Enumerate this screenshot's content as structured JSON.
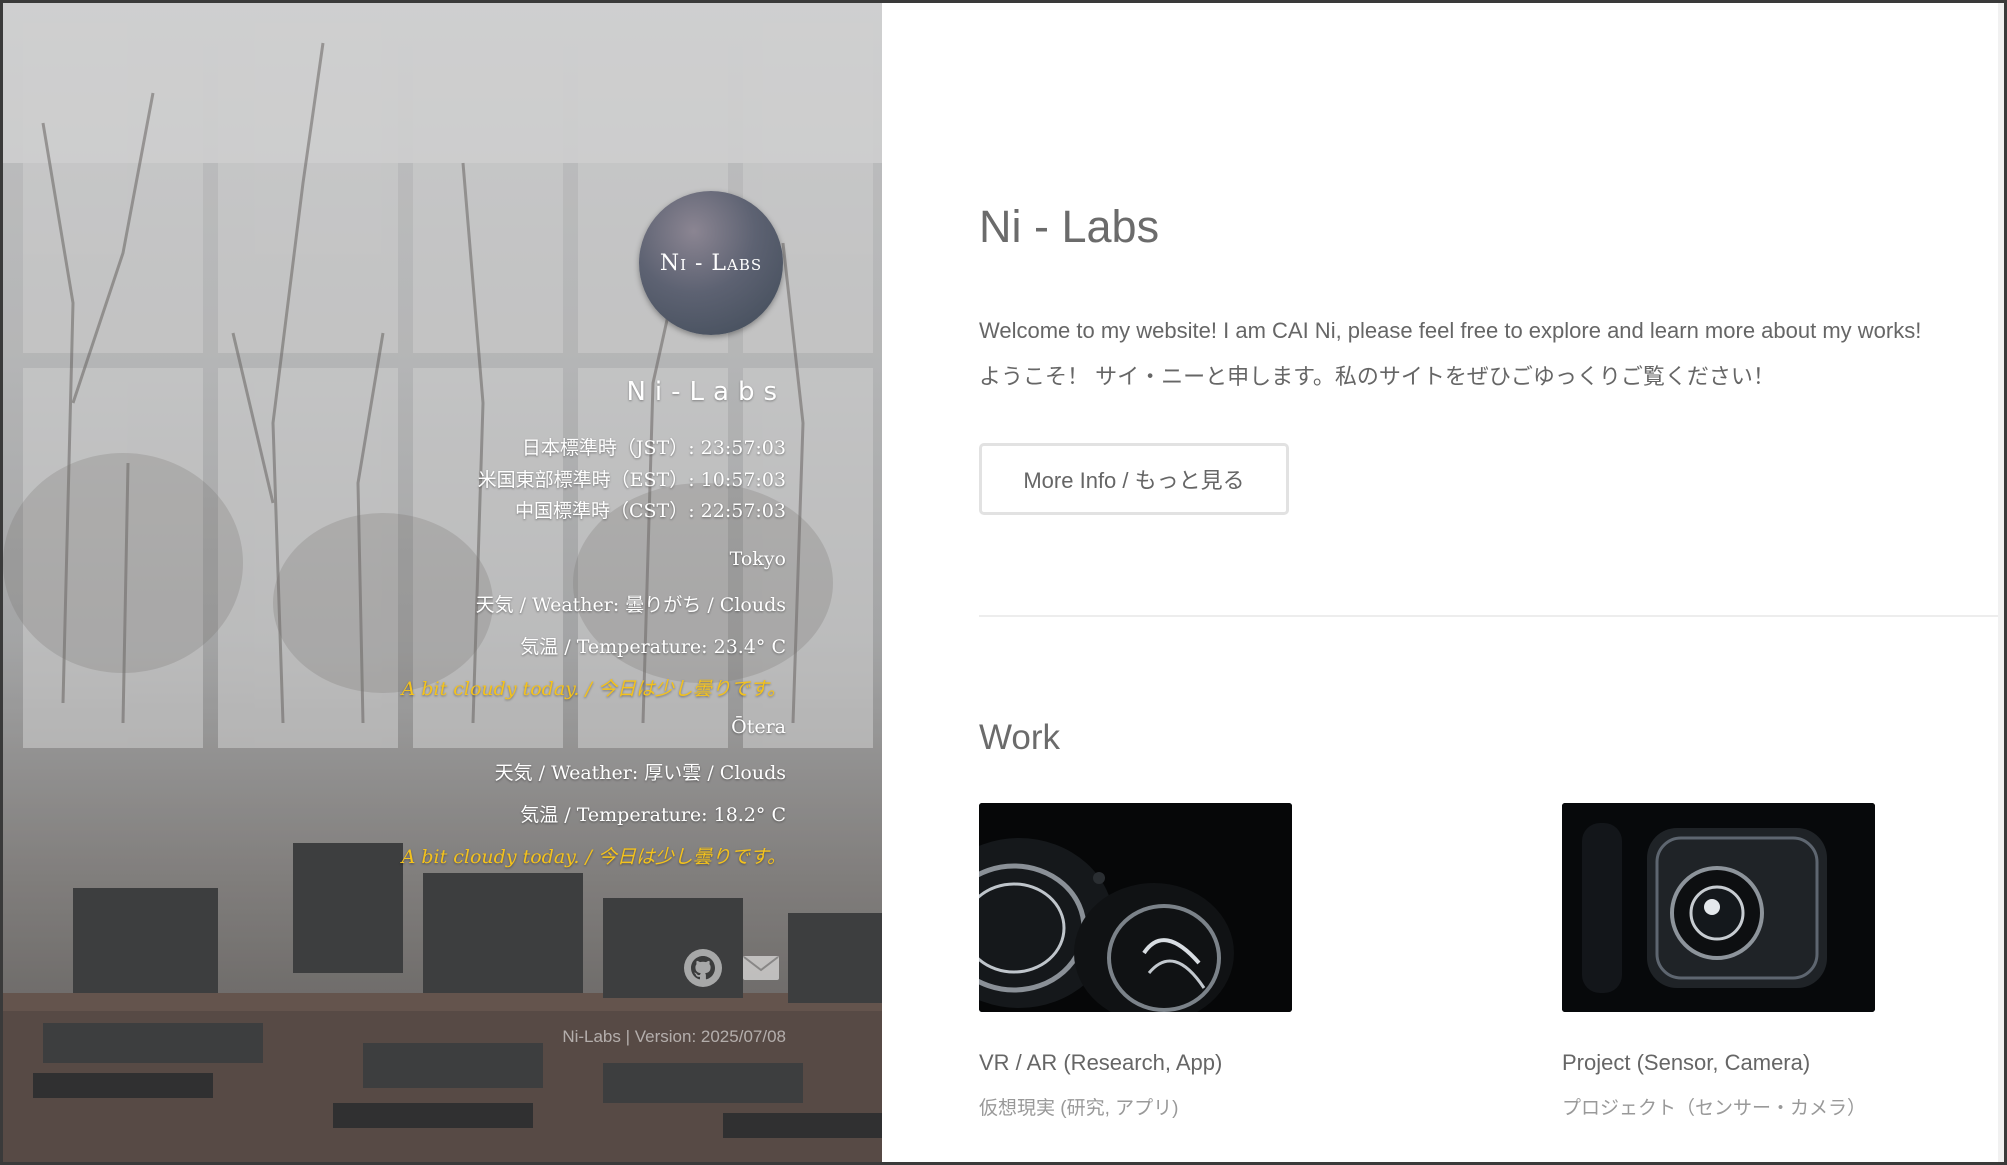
{
  "sidebar": {
    "logo_text": "Ni - Labs",
    "site_name": "Ni-Labs",
    "clocks": [
      "日本標準時（JST）: 23:57:03",
      "米国東部標準時（EST）: 10:57:03",
      "中国標準時（CST）: 22:57:03"
    ],
    "weather": [
      {
        "city": "Tokyo",
        "condition": "天気 / Weather: 曇りがち / Clouds",
        "temperature": "気温 / Temperature: 23.4° C",
        "message": "A bit cloudy today. / 今日は少し曇りです。"
      },
      {
        "city": "Ōtera",
        "condition": "天気 / Weather: 厚い雲 / Clouds",
        "temperature": "気温 / Temperature: 18.2° C",
        "message": "A bit cloudy today. / 今日は少し曇りです。"
      }
    ],
    "social": [
      "github-icon",
      "mail-icon"
    ],
    "footer": "Ni-Labs  |  Version: 2025/07/08"
  },
  "main": {
    "title": "Ni - Labs",
    "intro_en": "Welcome to my website! I am CAI Ni, please feel free to explore and learn more about my works!",
    "intro_jp": "ようこそ！ サイ・ニーと申します。私のサイトをぜひごゆっくりご覧ください！",
    "more_button": "More Info / もっと見る",
    "work_title": "Work",
    "works": [
      {
        "title": "VR / AR (Research, App)",
        "subtitle": "仮想現実 (研究, アプリ)"
      },
      {
        "title": "Project (Sensor, Camera)",
        "subtitle": "プロジェクト（センサー・カメラ）"
      }
    ]
  },
  "colors": {
    "accent_message": "#f4c21c",
    "heading": "#6b6b6b",
    "text": "#666666"
  }
}
